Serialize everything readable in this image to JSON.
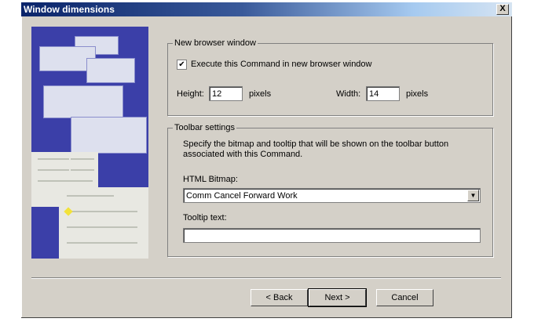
{
  "window": {
    "title": "Window dimensions",
    "close_label": "X"
  },
  "browser_group": {
    "label": "New browser window",
    "execute_checked": true,
    "execute_label": "Execute this Command in new browser window",
    "height_label": "Height:",
    "height_value": "12",
    "height_unit": "pixels",
    "width_label": "Width:",
    "width_value": "14",
    "width_unit": "pixels"
  },
  "toolbar_group": {
    "label": "Toolbar settings",
    "description_line1": "Specify the bitmap and tooltip that will be shown on the toolbar button",
    "description_line2": "associated with this Command.",
    "bitmap_label": "HTML Bitmap:",
    "bitmap_value": "Comm Cancel Forward Work",
    "tooltip_label": "Tooltip text:",
    "tooltip_value": ""
  },
  "buttons": {
    "back": "< Back",
    "next": "Next >",
    "cancel": "Cancel"
  }
}
